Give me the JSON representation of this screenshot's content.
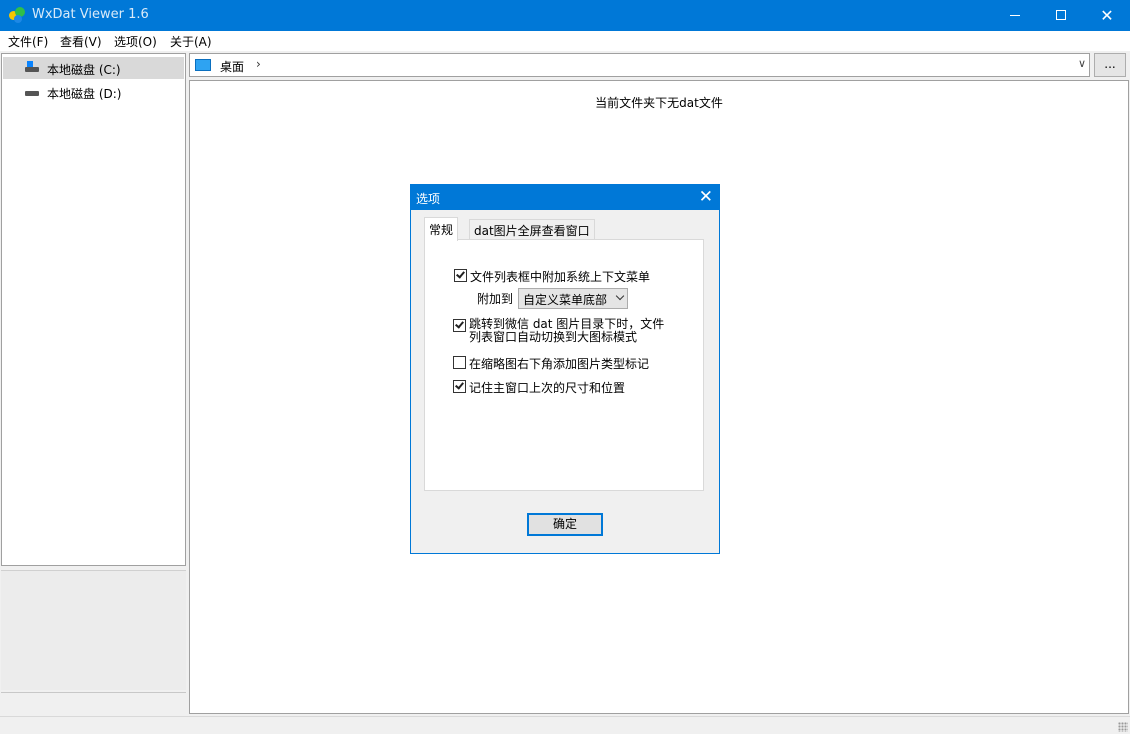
{
  "window": {
    "title": "WxDat Viewer 1.6",
    "minimize_icon": "minimize-icon",
    "maximize_icon": "maximize-icon",
    "close_glyph": "✕"
  },
  "menu": [
    {
      "label": "文件(F)"
    },
    {
      "label": "查看(V)"
    },
    {
      "label": "选项(O)"
    },
    {
      "label": "关于(A)"
    }
  ],
  "tree": {
    "items": [
      {
        "label": "本地磁盘 (C:)",
        "icon": "system-drive-icon",
        "selected": true
      },
      {
        "label": "本地磁盘 (D:)",
        "icon": "drive-icon",
        "selected": false
      }
    ]
  },
  "address": {
    "location": "桌面",
    "separator": "›",
    "dropdown_glyph": "∨",
    "more_label": "..."
  },
  "file_list": {
    "empty_message": "当前文件夹下无dat文件"
  },
  "dialog": {
    "title": "选项",
    "close_glyph": "✕",
    "tabs": [
      {
        "label": "常规",
        "active": true
      },
      {
        "label": "dat图片全屏查看窗口",
        "active": false
      }
    ],
    "options": {
      "context_menu": {
        "label": "文件列表框中附加系统上下文菜单",
        "checked": true
      },
      "attach_to_label": "附加到",
      "attach_to_value": "自定义菜单底部",
      "auto_switch": {
        "label_line1": "跳转到微信 dat 图片目录下时，文件",
        "label_line2": "列表窗口自动切换到大图标模式",
        "checked": true
      },
      "type_mark": {
        "label": "在缩略图右下角添加图片类型标记",
        "checked": false
      },
      "remember_pos": {
        "label": "记住主窗口上次的尺寸和位置",
        "checked": true
      }
    },
    "ok_label": "确定"
  },
  "colors": {
    "accent": "#0078d7"
  }
}
